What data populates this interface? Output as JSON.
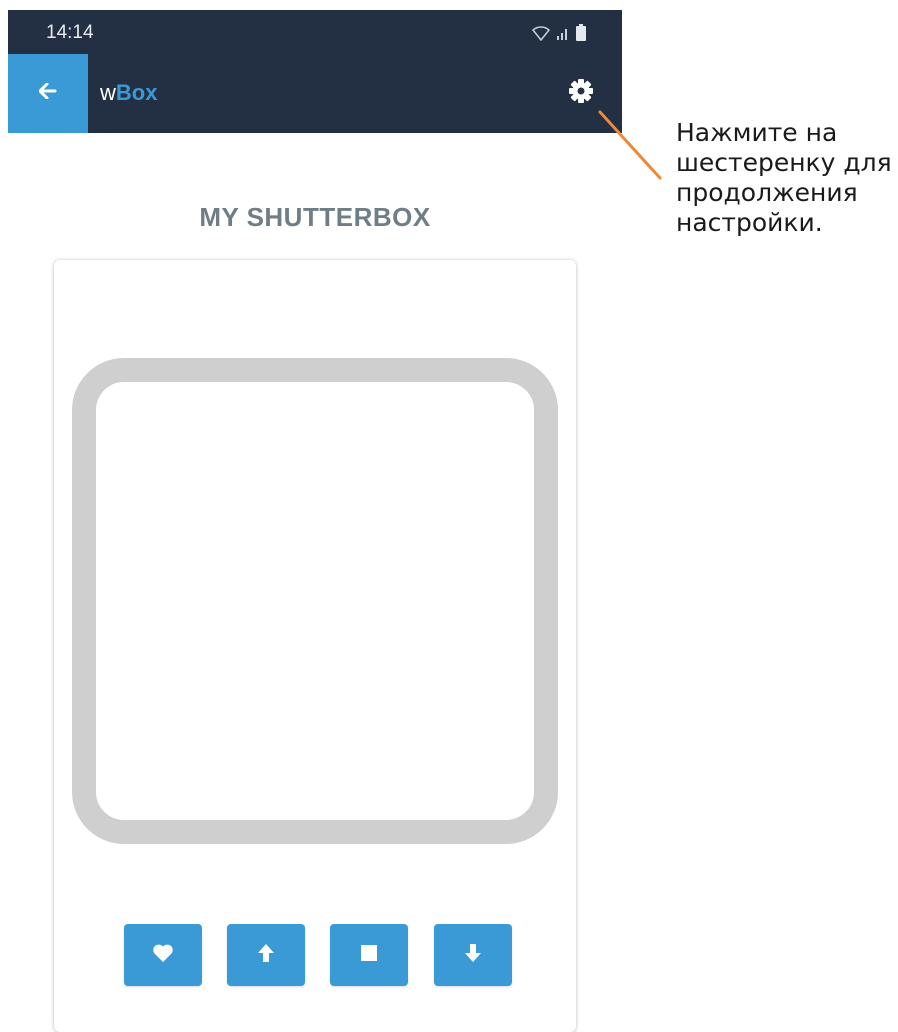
{
  "status_bar": {
    "time": "14:14"
  },
  "app_bar": {
    "title_prefix": "w",
    "title_accent": "Box"
  },
  "device": {
    "title": "MY SHUTTERBOX"
  },
  "annotation": {
    "text": "Нажмите на\nшестеренку для\nпродолжения\nнастройки."
  },
  "icons": {
    "back": "arrow-left-icon",
    "settings": "gear-icon",
    "favorite": "heart-icon",
    "up": "arrow-up-icon",
    "stop": "stop-icon",
    "down": "arrow-down-icon",
    "wifi": "wifi-icon",
    "signal": "signal-icon",
    "battery": "battery-icon"
  },
  "colors": {
    "app_bar": "#232f43",
    "accent": "#3a9ad5",
    "shutter_frame": "#cfcfcf",
    "device_title": "#6f7d86",
    "annotation_line": "#f0883a"
  }
}
